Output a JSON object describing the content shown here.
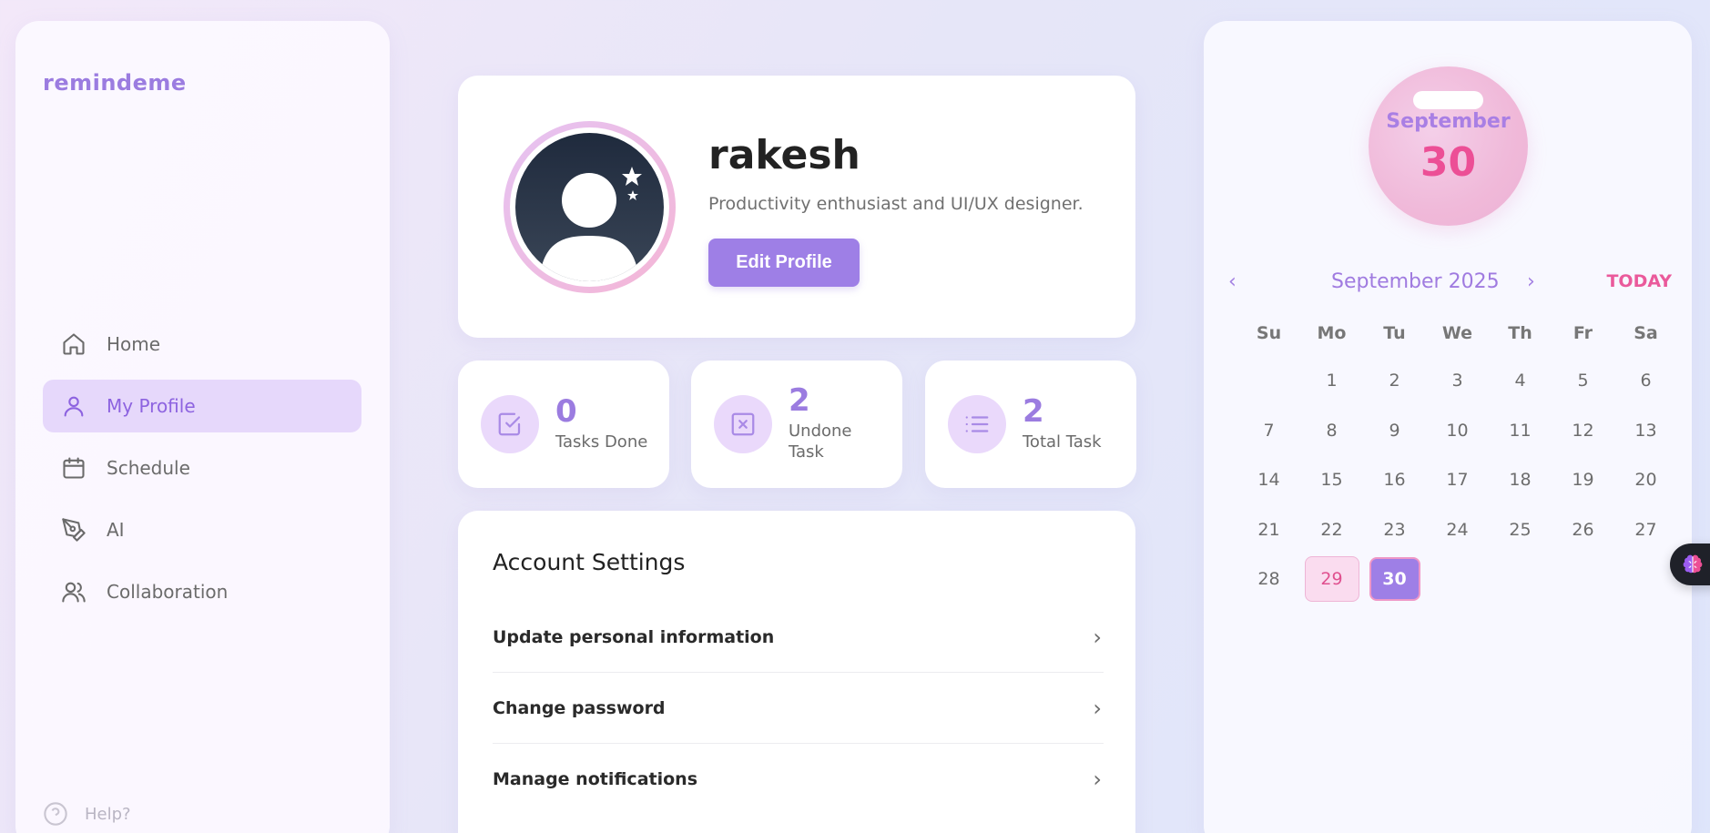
{
  "app": {
    "brand": "remindeme"
  },
  "sidebar": {
    "items": [
      {
        "label": "Home",
        "icon": "home-icon",
        "active": false
      },
      {
        "label": "My Profile",
        "icon": "user-icon",
        "active": true
      },
      {
        "label": "Schedule",
        "icon": "calendar-icon",
        "active": false
      },
      {
        "label": "AI",
        "icon": "pen-tool-icon",
        "active": false
      },
      {
        "label": "Collaboration",
        "icon": "users-icon",
        "active": false
      }
    ],
    "help_label": "Help?"
  },
  "profile": {
    "name": "rakesh",
    "bio": "Productivity enthusiast and UI/UX designer.",
    "edit_label": "Edit Profile"
  },
  "stats": [
    {
      "value": "0",
      "label": "Tasks Done",
      "icon": "check-square-icon"
    },
    {
      "value": "2",
      "label": "Undone Task",
      "icon": "x-square-icon"
    },
    {
      "value": "2",
      "label": "Total Task",
      "icon": "list-icon"
    }
  ],
  "settings": {
    "title": "Account Settings",
    "items": [
      {
        "label": "Update personal information"
      },
      {
        "label": "Change password"
      },
      {
        "label": "Manage notifications"
      }
    ]
  },
  "calendar": {
    "badge_month": "September",
    "badge_day": "30",
    "title": "September 2025",
    "prev": "‹",
    "next": "›",
    "today_label": "TODAY",
    "weekdays": [
      "Su",
      "Mo",
      "Tu",
      "We",
      "Th",
      "Fr",
      "Sa"
    ],
    "weeks": [
      [
        "",
        "1",
        "2",
        "3",
        "4",
        "5",
        "6"
      ],
      [
        "7",
        "8",
        "9",
        "10",
        "11",
        "12",
        "13"
      ],
      [
        "14",
        "15",
        "16",
        "17",
        "18",
        "19",
        "20"
      ],
      [
        "21",
        "22",
        "23",
        "24",
        "25",
        "26",
        "27"
      ],
      [
        "28",
        "29",
        "30",
        "",
        "",
        "",
        ""
      ]
    ],
    "highlighted_day": "29",
    "selected_day": "30"
  },
  "colors": {
    "accent": "#9e7fe6",
    "accent_light": "#e6d8fb",
    "pink": "#ec4f96"
  }
}
